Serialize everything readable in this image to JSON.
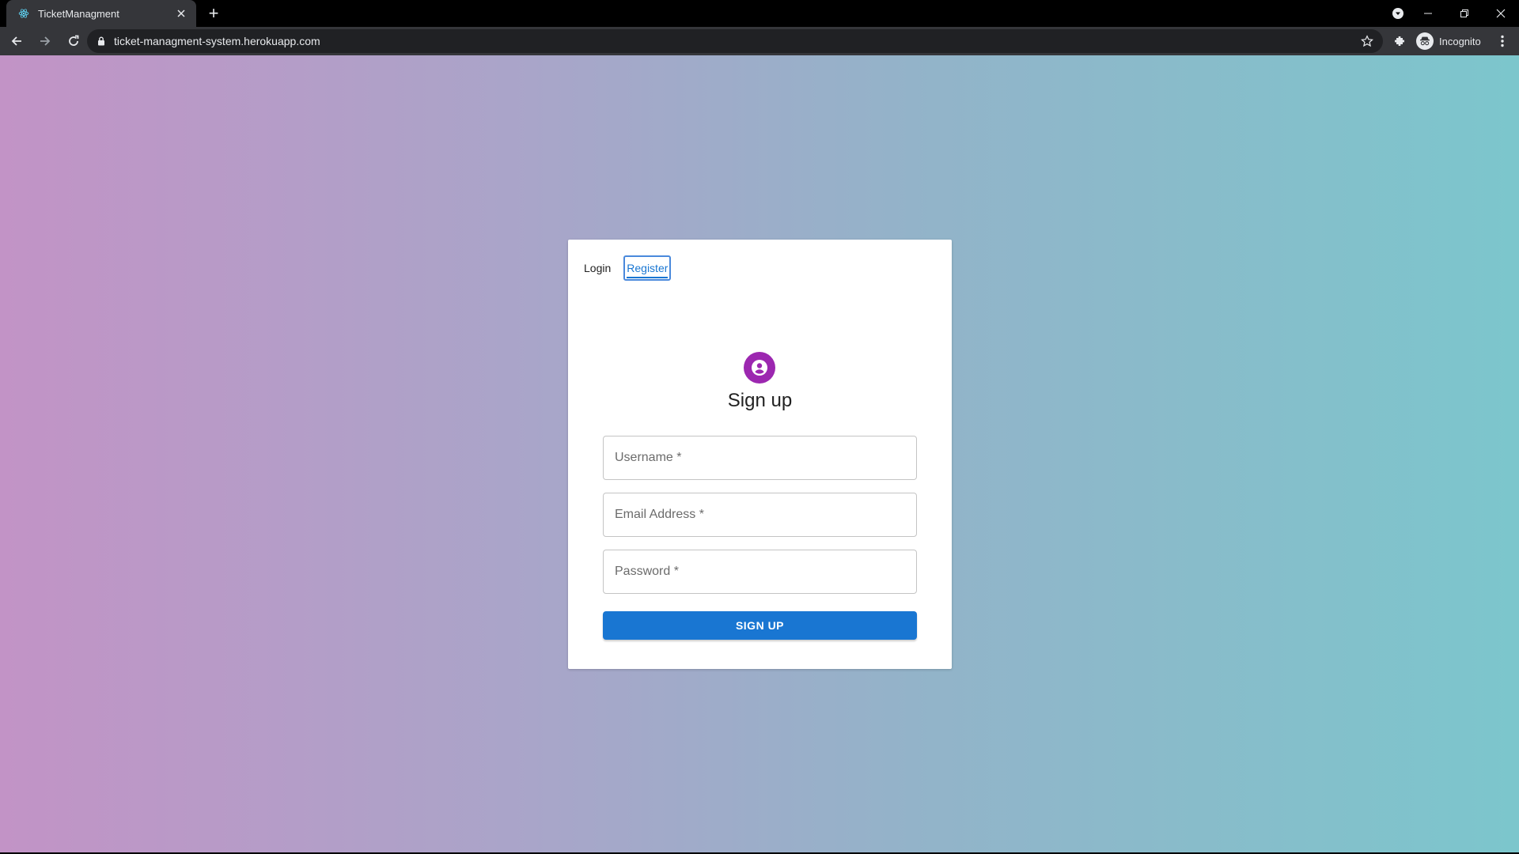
{
  "browser": {
    "tab_title": "TicketManagment",
    "new_tab_label": "+",
    "url": "ticket-managment-system.herokuapp.com",
    "profile_label": "Incognito"
  },
  "auth": {
    "tabs": [
      {
        "label": "Login",
        "active": false
      },
      {
        "label": "Register",
        "active": true
      }
    ],
    "heading": "Sign up",
    "fields": {
      "username_placeholder": "Username *",
      "email_placeholder": "Email Address *",
      "password_placeholder": "Password *"
    },
    "submit_label": "SIGN UP"
  },
  "colors": {
    "primary": "#1976d2",
    "avatar": "#9c27b0"
  },
  "icons": [
    "react-icon",
    "close-icon",
    "back-icon",
    "forward-icon",
    "reload-icon",
    "lock-icon",
    "star-icon",
    "puzzle-icon",
    "incognito-icon",
    "menu-icon",
    "person-icon",
    "media-icon",
    "minimize-icon",
    "restore-icon"
  ]
}
